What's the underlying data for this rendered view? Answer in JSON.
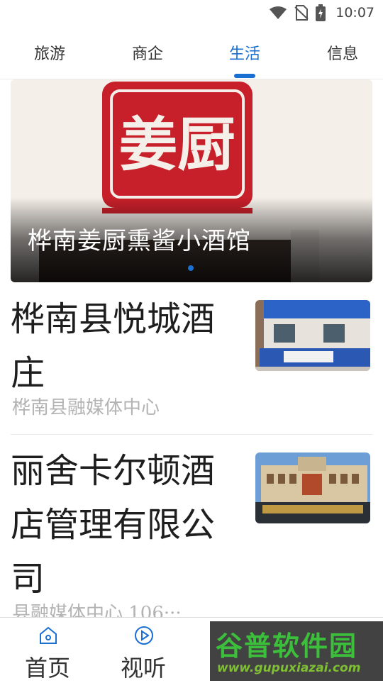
{
  "status_bar": {
    "time": "10:07",
    "icons": [
      "wifi-icon",
      "no-sim-icon",
      "battery-charging-icon"
    ]
  },
  "tabs": [
    {
      "label": "旅游",
      "active": false
    },
    {
      "label": "商企",
      "active": false
    },
    {
      "label": "生活",
      "active": true
    },
    {
      "label": "信息",
      "active": false
    }
  ],
  "banner": {
    "title": "桦南姜厨熏酱小酒馆",
    "logo_text": "姜厨",
    "page_index": 1
  },
  "articles": [
    {
      "title_lines": [
        "桦南县悦城酒",
        "庄"
      ],
      "meta": "桦南县融媒体中心",
      "thumb_icon": "storefront-photo"
    },
    {
      "title_lines": [
        "丽舍卡尔顿酒",
        "店管理有限公",
        "司"
      ],
      "meta": "县融媒体中心    106···",
      "thumb_icon": "hotel-building-photo"
    }
  ],
  "bottom_nav": [
    {
      "label": "首页",
      "icon": "home-icon"
    },
    {
      "label": "视听",
      "icon": "play-circle-icon"
    }
  ],
  "watermark": {
    "name": "谷普软件园",
    "url": "www.gupuxiazai.com"
  },
  "colors": {
    "accent": "#1a6fd3",
    "meta_gray": "#b3b3b3",
    "logo_red": "#c8202a"
  }
}
